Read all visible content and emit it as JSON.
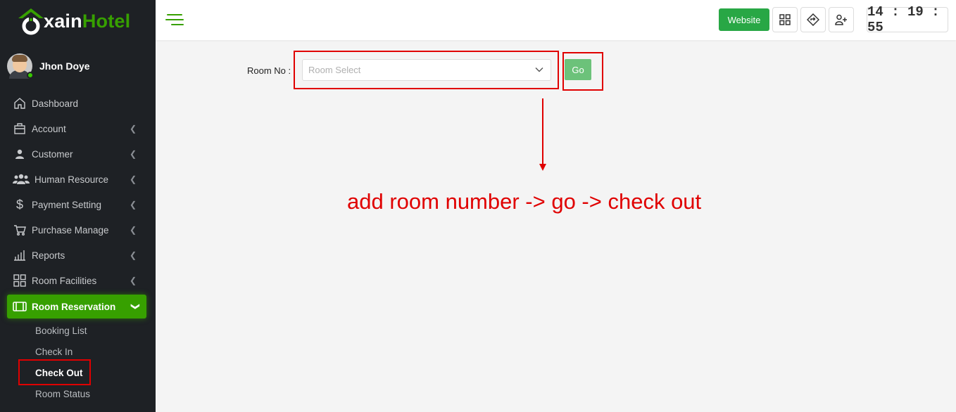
{
  "brand": {
    "prefix": "xain",
    "suffix": "Hotel",
    "accent": "#37a000"
  },
  "user": {
    "name": "Jhon Doye",
    "status": "online"
  },
  "sidebar": {
    "items": [
      {
        "label": "Dashboard",
        "icon": "home-icon",
        "has_children": false
      },
      {
        "label": "Account",
        "icon": "briefcase-icon",
        "has_children": true
      },
      {
        "label": "Customer",
        "icon": "user-icon",
        "has_children": true
      },
      {
        "label": "Human Resource",
        "icon": "users-icon",
        "has_children": true
      },
      {
        "label": "Payment Setting",
        "icon": "dollar-icon",
        "has_children": true
      },
      {
        "label": "Purchase Manage",
        "icon": "cart-icon",
        "has_children": true
      },
      {
        "label": "Reports",
        "icon": "bar-chart-icon",
        "has_children": true
      },
      {
        "label": "Room Facilities",
        "icon": "grid-icon",
        "has_children": true
      },
      {
        "label": "Room Reservation",
        "icon": "ticket-icon",
        "has_children": true,
        "active": true
      }
    ],
    "submenu": [
      "Booking List",
      "Check In",
      "Check Out",
      "Room Status"
    ],
    "current_sub": "Check Out"
  },
  "topbar": {
    "website_label": "Website",
    "clock": "14 : 19 : 55"
  },
  "form": {
    "room_label": "Room No :",
    "room_placeholder": "Room Select",
    "go_label": "Go"
  },
  "annotation": {
    "text": "add room number -> go -> check out",
    "color": "#e00000"
  }
}
